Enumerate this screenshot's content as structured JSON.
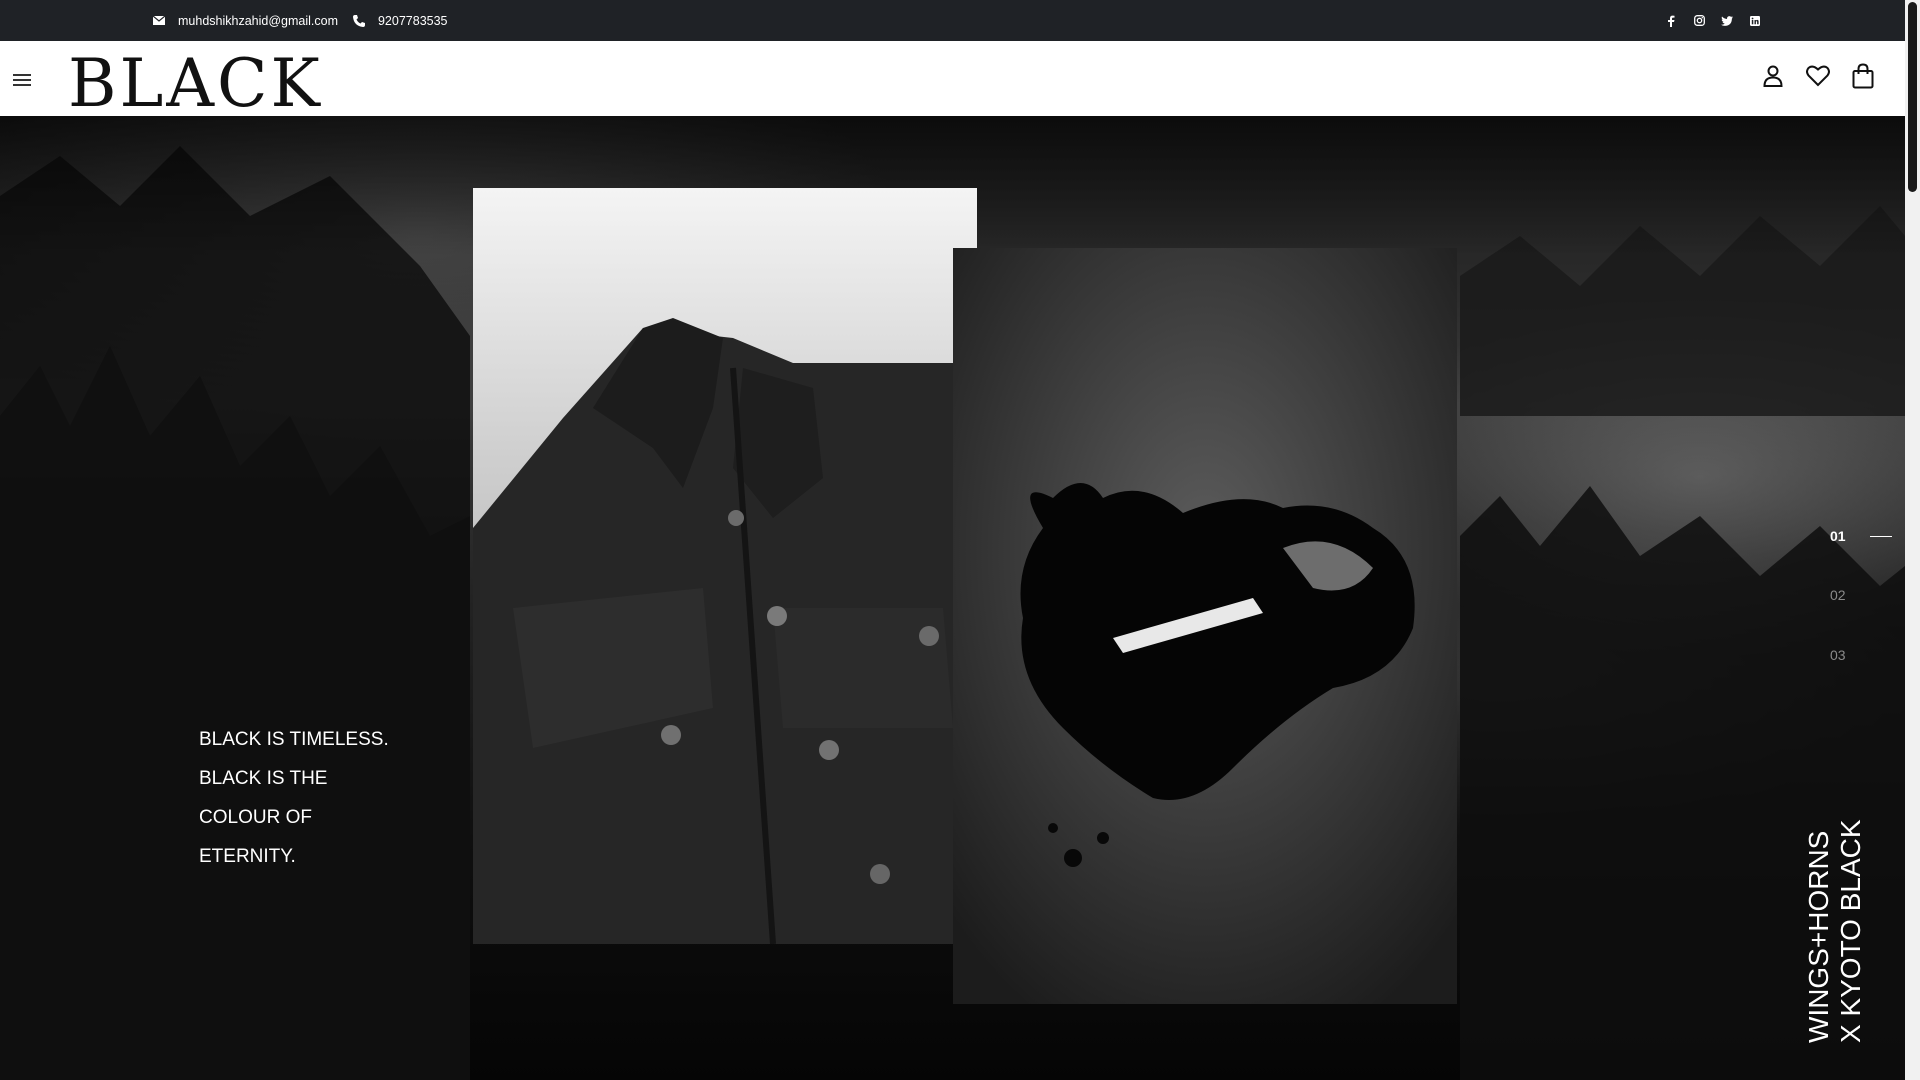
{
  "topbar": {
    "email": "muhdshikhzahid@gmail.com",
    "phone": "9207783535",
    "socials": [
      "facebook-icon",
      "instagram-icon",
      "twitter-icon",
      "linkedin-icon"
    ]
  },
  "header": {
    "logo": "BLACK",
    "icons": [
      "user-icon",
      "heart-icon",
      "bag-icon"
    ]
  },
  "hero": {
    "tagline": "BLACK IS TIMELESS. BLACK IS THE COLOUR OF ETERNITY.",
    "slides": [
      "01",
      "02",
      "03"
    ],
    "active_slide": "01",
    "collection_title_line1": "WINGS+HORNS",
    "collection_title_line2": "X KYOTO BLACK"
  },
  "colors": {
    "topbar_bg": "#1f2226",
    "header_bg": "#ffffff",
    "text_light": "#ffffff",
    "inactive_slide": "#8a8a8a"
  }
}
